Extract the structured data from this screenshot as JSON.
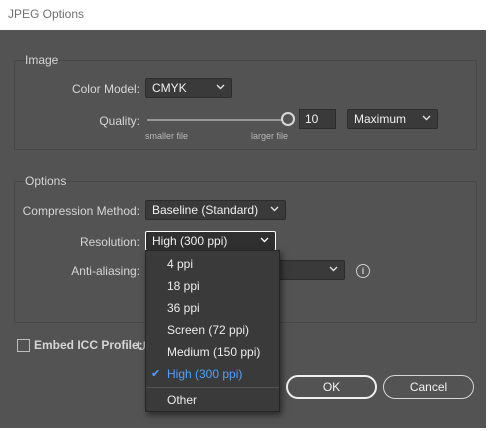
{
  "window": {
    "title": "JPEG Options"
  },
  "image_group": {
    "title": "Image",
    "color_model_label": "Color Model:",
    "color_model_value": "CMYK",
    "quality_label": "Quality:",
    "quality_value": "10",
    "quality_preset": "Maximum",
    "slider_left_caption": "smaller file",
    "slider_right_caption": "larger file",
    "quality_slider_level": 1.0
  },
  "options_group": {
    "title": "Options",
    "compression_label": "Compression Method:",
    "compression_value": "Baseline (Standard)",
    "resolution_label": "Resolution:",
    "resolution_value": "High (300 ppi)",
    "antialiasing_label": "Anti-aliasing:"
  },
  "resolution_menu": {
    "items": [
      {
        "label": "4 ppi",
        "selected": false
      },
      {
        "label": "18 ppi",
        "selected": false
      },
      {
        "label": "36 ppi",
        "selected": false
      },
      {
        "label": "Screen (72 ppi)",
        "selected": false
      },
      {
        "label": "Medium (150 ppi)",
        "selected": false
      },
      {
        "label": "High (300 ppi)",
        "selected": true
      },
      {
        "label": "Other",
        "selected": false
      }
    ],
    "check_glyph": "✔"
  },
  "embed_icc": {
    "label": "Embed ICC Profile:",
    "value_partial": "U"
  },
  "buttons": {
    "ok": "OK",
    "cancel": "Cancel"
  },
  "icons": {
    "info": "info-icon",
    "chevron": "chevron-down-icon"
  },
  "colors": {
    "selected_item": "#4ea2ff",
    "background": "#535353"
  }
}
